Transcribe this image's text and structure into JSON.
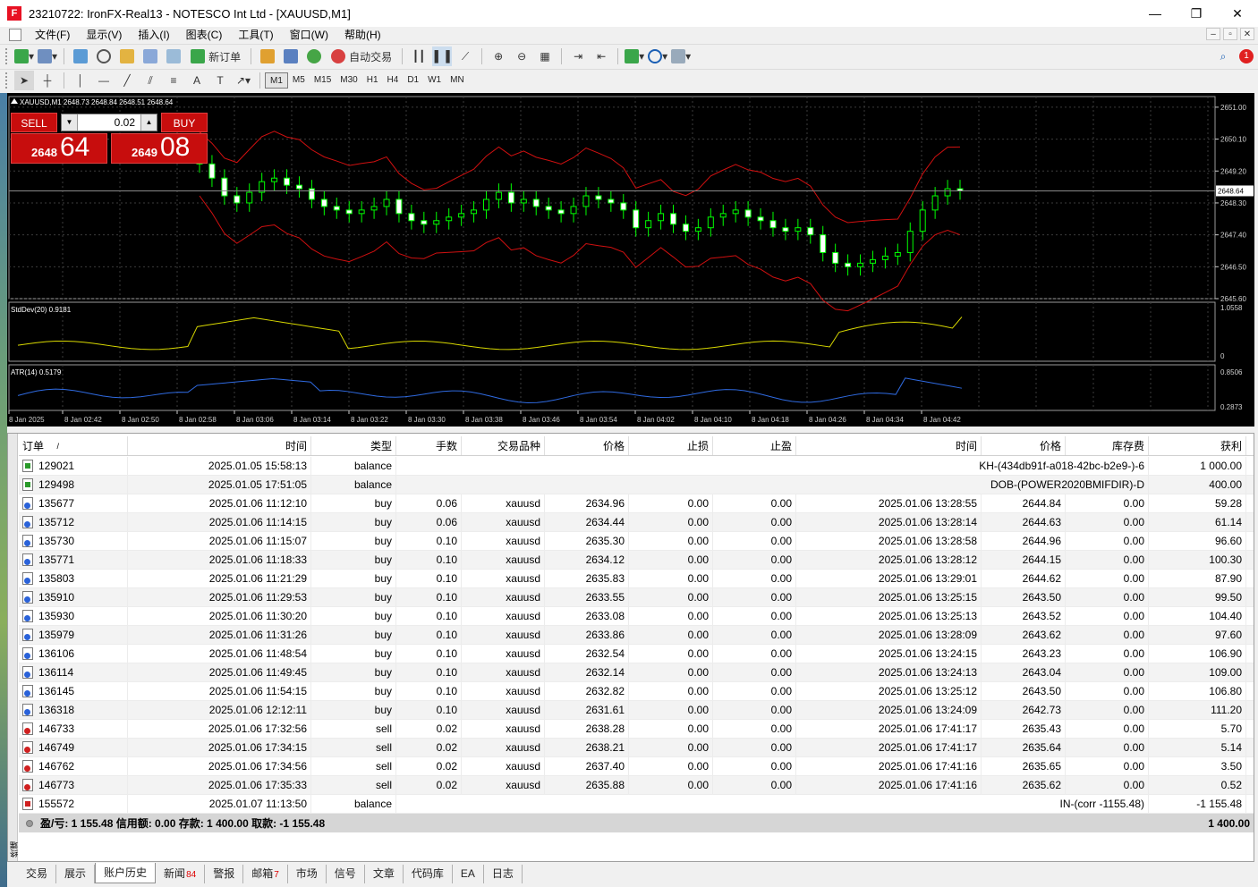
{
  "window": {
    "title": "23210722: IronFX-Real13 - NOTESCO Int Ltd - [XAUUSD,M1]",
    "app_icon": "F",
    "minimize": "—",
    "maximize": "❐",
    "close": "✕"
  },
  "menu": [
    "文件(F)",
    "显示(V)",
    "插入(I)",
    "图表(C)",
    "工具(T)",
    "窗口(W)",
    "帮助(H)"
  ],
  "toolbar1": {
    "new_order": "新订单",
    "auto_trading": "自动交易",
    "notification_count": "1"
  },
  "timeframes": [
    "M1",
    "M5",
    "M15",
    "M30",
    "H1",
    "H4",
    "D1",
    "W1",
    "MN"
  ],
  "chart": {
    "symbol_info": "XAUUSD,M1  2648.73 2648.84 2648.51 2648.64",
    "trade_panel": {
      "sell_label": "SELL",
      "buy_label": "BUY",
      "lot": "0.02",
      "sell_small": "2648",
      "sell_big": "64",
      "buy_small": "2649",
      "buy_big": "08"
    },
    "price_axis": [
      "2651.00",
      "2650.10",
      "2649.20",
      "2648.30",
      "2647.40",
      "2646.50",
      "2645.60"
    ],
    "current_price": "2648.64",
    "stddev_label": "StdDev(20) 0.9181",
    "stddev_axis": [
      "1.0558",
      "0"
    ],
    "atr_label": "ATR(14) 0.5179",
    "atr_axis": [
      "0.8506",
      "0.2873"
    ],
    "time_axis": [
      "8 Jan 2025",
      "8 Jan 02:42",
      "8 Jan 02:50",
      "8 Jan 02:58",
      "8 Jan 03:06",
      "8 Jan 03:14",
      "8 Jan 03:22",
      "8 Jan 03:30",
      "8 Jan 03:38",
      "8 Jan 03:46",
      "8 Jan 03:54",
      "8 Jan 04:02",
      "8 Jan 04:10",
      "8 Jan 04:18",
      "8 Jan 04:26",
      "8 Jan 04:34",
      "8 Jan 04:42"
    ]
  },
  "chart_data": {
    "type": "line",
    "title": "XAUUSD,M1",
    "xlabel": "",
    "ylabel": "",
    "ylim": [
      2645.6,
      2651.3
    ],
    "close_series_approx": [
      2649.4,
      2649.0,
      2648.5,
      2648.3,
      2648.6,
      2648.9,
      2649.0,
      2648.8,
      2648.7,
      2648.4,
      2648.2,
      2648.1,
      2648.0,
      2648.1,
      2648.2,
      2648.4,
      2648.0,
      2647.8,
      2647.7,
      2647.8,
      2647.9,
      2648.0,
      2648.1,
      2648.4,
      2648.6,
      2648.3,
      2648.4,
      2648.2,
      2648.1,
      2648.0,
      2648.2,
      2648.5,
      2648.4,
      2648.3,
      2648.1,
      2647.6,
      2647.8,
      2648.0,
      2647.7,
      2647.5,
      2647.6,
      2647.9,
      2648.0,
      2648.1,
      2647.9,
      2647.8,
      2647.6,
      2647.5,
      2647.6,
      2647.4,
      2646.9,
      2646.6,
      2646.5,
      2646.6,
      2646.7,
      2646.8,
      2646.9,
      2647.5,
      2648.1,
      2648.5,
      2648.7,
      2648.64
    ],
    "series": [
      {
        "name": "StdDev(20)",
        "last": 0.9181
      },
      {
        "name": "ATR(14)",
        "last": 0.5179
      }
    ]
  },
  "terminal": {
    "columns": [
      "订单",
      "时间",
      "类型",
      "手数",
      "交易品种",
      "价格",
      "止损",
      "止盈",
      "时间",
      "价格",
      "库存费",
      "获利"
    ],
    "sort_marker": "/",
    "rows": [
      {
        "icon": "bal",
        "t": "129021",
        "ot": "2025.01.05 15:58:13",
        "type": "balance",
        "comment": "KH-(434db91f-a018-42bc-b2e9-)-6",
        "profit": "1 000.00"
      },
      {
        "icon": "bal",
        "t": "129498",
        "ot": "2025.01.05 17:51:05",
        "type": "balance",
        "comment": "DOB-(POWER2020BMIFDIR)-D",
        "profit": "400.00"
      },
      {
        "icon": "buy",
        "t": "135677",
        "ot": "2025.01.06 11:12:10",
        "type": "buy",
        "lots": "0.06",
        "sym": "xauusd",
        "op": "2634.96",
        "sl": "0.00",
        "tp": "0.00",
        "ct": "2025.01.06 13:28:55",
        "cp": "2644.84",
        "swap": "0.00",
        "profit": "59.28"
      },
      {
        "icon": "buy",
        "t": "135712",
        "ot": "2025.01.06 11:14:15",
        "type": "buy",
        "lots": "0.06",
        "sym": "xauusd",
        "op": "2634.44",
        "sl": "0.00",
        "tp": "0.00",
        "ct": "2025.01.06 13:28:14",
        "cp": "2644.63",
        "swap": "0.00",
        "profit": "61.14"
      },
      {
        "icon": "buy",
        "t": "135730",
        "ot": "2025.01.06 11:15:07",
        "type": "buy",
        "lots": "0.10",
        "sym": "xauusd",
        "op": "2635.30",
        "sl": "0.00",
        "tp": "0.00",
        "ct": "2025.01.06 13:28:58",
        "cp": "2644.96",
        "swap": "0.00",
        "profit": "96.60"
      },
      {
        "icon": "buy",
        "t": "135771",
        "ot": "2025.01.06 11:18:33",
        "type": "buy",
        "lots": "0.10",
        "sym": "xauusd",
        "op": "2634.12",
        "sl": "0.00",
        "tp": "0.00",
        "ct": "2025.01.06 13:28:12",
        "cp": "2644.15",
        "swap": "0.00",
        "profit": "100.30"
      },
      {
        "icon": "buy",
        "t": "135803",
        "ot": "2025.01.06 11:21:29",
        "type": "buy",
        "lots": "0.10",
        "sym": "xauusd",
        "op": "2635.83",
        "sl": "0.00",
        "tp": "0.00",
        "ct": "2025.01.06 13:29:01",
        "cp": "2644.62",
        "swap": "0.00",
        "profit": "87.90"
      },
      {
        "icon": "buy",
        "t": "135910",
        "ot": "2025.01.06 11:29:53",
        "type": "buy",
        "lots": "0.10",
        "sym": "xauusd",
        "op": "2633.55",
        "sl": "0.00",
        "tp": "0.00",
        "ct": "2025.01.06 13:25:15",
        "cp": "2643.50",
        "swap": "0.00",
        "profit": "99.50"
      },
      {
        "icon": "buy",
        "t": "135930",
        "ot": "2025.01.06 11:30:20",
        "type": "buy",
        "lots": "0.10",
        "sym": "xauusd",
        "op": "2633.08",
        "sl": "0.00",
        "tp": "0.00",
        "ct": "2025.01.06 13:25:13",
        "cp": "2643.52",
        "swap": "0.00",
        "profit": "104.40"
      },
      {
        "icon": "buy",
        "t": "135979",
        "ot": "2025.01.06 11:31:26",
        "type": "buy",
        "lots": "0.10",
        "sym": "xauusd",
        "op": "2633.86",
        "sl": "0.00",
        "tp": "0.00",
        "ct": "2025.01.06 13:28:09",
        "cp": "2643.62",
        "swap": "0.00",
        "profit": "97.60"
      },
      {
        "icon": "buy",
        "t": "136106",
        "ot": "2025.01.06 11:48:54",
        "type": "buy",
        "lots": "0.10",
        "sym": "xauusd",
        "op": "2632.54",
        "sl": "0.00",
        "tp": "0.00",
        "ct": "2025.01.06 13:24:15",
        "cp": "2643.23",
        "swap": "0.00",
        "profit": "106.90"
      },
      {
        "icon": "buy",
        "t": "136114",
        "ot": "2025.01.06 11:49:45",
        "type": "buy",
        "lots": "0.10",
        "sym": "xauusd",
        "op": "2632.14",
        "sl": "0.00",
        "tp": "0.00",
        "ct": "2025.01.06 13:24:13",
        "cp": "2643.04",
        "swap": "0.00",
        "profit": "109.00"
      },
      {
        "icon": "buy",
        "t": "136145",
        "ot": "2025.01.06 11:54:15",
        "type": "buy",
        "lots": "0.10",
        "sym": "xauusd",
        "op": "2632.82",
        "sl": "0.00",
        "tp": "0.00",
        "ct": "2025.01.06 13:25:12",
        "cp": "2643.50",
        "swap": "0.00",
        "profit": "106.80"
      },
      {
        "icon": "buy",
        "t": "136318",
        "ot": "2025.01.06 12:12:11",
        "type": "buy",
        "lots": "0.10",
        "sym": "xauusd",
        "op": "2631.61",
        "sl": "0.00",
        "tp": "0.00",
        "ct": "2025.01.06 13:24:09",
        "cp": "2642.73",
        "swap": "0.00",
        "profit": "111.20"
      },
      {
        "icon": "sell",
        "t": "146733",
        "ot": "2025.01.06 17:32:56",
        "type": "sell",
        "lots": "0.02",
        "sym": "xauusd",
        "op": "2638.28",
        "sl": "0.00",
        "tp": "0.00",
        "ct": "2025.01.06 17:41:17",
        "cp": "2635.43",
        "swap": "0.00",
        "profit": "5.70"
      },
      {
        "icon": "sell",
        "t": "146749",
        "ot": "2025.01.06 17:34:15",
        "type": "sell",
        "lots": "0.02",
        "sym": "xauusd",
        "op": "2638.21",
        "sl": "0.00",
        "tp": "0.00",
        "ct": "2025.01.06 17:41:17",
        "cp": "2635.64",
        "swap": "0.00",
        "profit": "5.14"
      },
      {
        "icon": "sell",
        "t": "146762",
        "ot": "2025.01.06 17:34:56",
        "type": "sell",
        "lots": "0.02",
        "sym": "xauusd",
        "op": "2637.40",
        "sl": "0.00",
        "tp": "0.00",
        "ct": "2025.01.06 17:41:16",
        "cp": "2635.65",
        "swap": "0.00",
        "profit": "3.50"
      },
      {
        "icon": "sell",
        "t": "146773",
        "ot": "2025.01.06 17:35:33",
        "type": "sell",
        "lots": "0.02",
        "sym": "xauusd",
        "op": "2635.88",
        "sl": "0.00",
        "tp": "0.00",
        "ct": "2025.01.06 17:41:16",
        "cp": "2635.62",
        "swap": "0.00",
        "profit": "0.52"
      },
      {
        "icon": "balneg",
        "t": "155572",
        "ot": "2025.01.07 11:13:50",
        "type": "balance",
        "comment": "IN-(corr -1155.48)",
        "profit": "-1 155.48"
      }
    ],
    "summary": "盈/亏: 1 155.48  信用额: 0.00  存款: 1 400.00  取款: -1 155.48",
    "summary_total": "1 400.00",
    "side_label": "终端"
  },
  "tabs": [
    {
      "label": "交易"
    },
    {
      "label": "展示"
    },
    {
      "label": "账户历史",
      "active": true
    },
    {
      "label": "新闻",
      "badge": "84"
    },
    {
      "label": "警报"
    },
    {
      "label": "邮箱",
      "badge": "7"
    },
    {
      "label": "市场"
    },
    {
      "label": "信号"
    },
    {
      "label": "文章"
    },
    {
      "label": "代码库"
    },
    {
      "label": "EA"
    },
    {
      "label": "日志"
    }
  ],
  "colors": {
    "bull": "#00ff00",
    "bear": "#00ff00",
    "band": "#d01010",
    "stddev": "#d8d800",
    "atr": "#2f6ae0",
    "grid": "#3a3a3a",
    "trade_red": "#c70d0d"
  }
}
